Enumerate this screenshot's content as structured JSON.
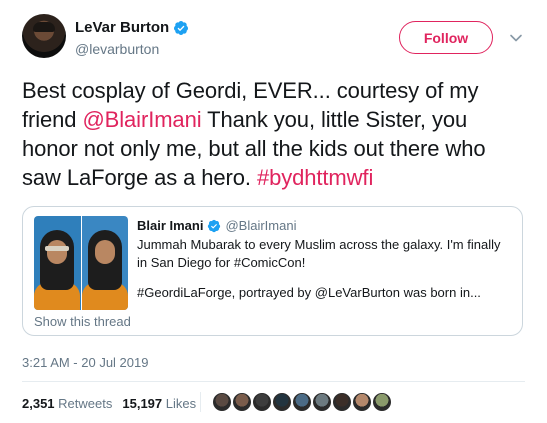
{
  "author": {
    "name": "LeVar Burton",
    "handle": "@levarburton"
  },
  "follow_label": "Follow",
  "tweet": {
    "part1": "Best cosplay of Geordi, EVER... courtesy of my friend ",
    "mention": "@BlairImani",
    "part2": " Thank you, little Sister, you honor not only me, but all the kids out there who saw LaForge as a hero.  ",
    "hashtag": "#bydhttmwfi"
  },
  "quote": {
    "name": "Blair Imani",
    "handle": "@BlairImani",
    "line1": "Jummah Mubarak to every Muslim across the galaxy. I'm finally in San Diego for #ComicCon!",
    "line2": "#GeordiLaForge, portrayed by @LeVarBurton was born in...",
    "show_thread": "Show this thread"
  },
  "timestamp": "3:21 AM - 20 Jul 2019",
  "stats": {
    "retweets_count": "2,351",
    "retweets_label": "Retweets",
    "likes_count": "15,197",
    "likes_label": "Likes"
  },
  "colors": {
    "accent": "#e0245e",
    "verified": "#1da1f2",
    "muted": "#657786"
  },
  "liker_avatars": [
    "#5a4a42",
    "#7a5c4b",
    "#3d3d3d",
    "#22343f",
    "#4b6b86",
    "#6c7a80",
    "#3b2e28",
    "#b4886b",
    "#8a9a6b"
  ]
}
